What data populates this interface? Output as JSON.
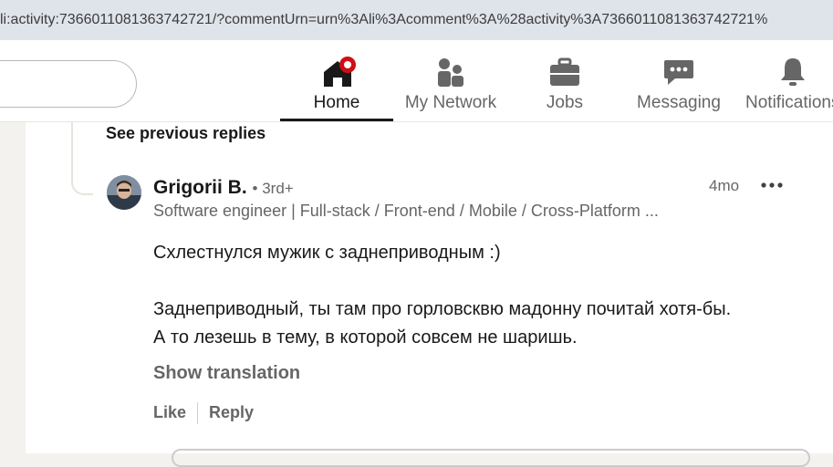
{
  "browser": {
    "url": "li:activity:7366011081363742721/?commentUrn=urn%3Ali%3Acomment%3A%28activity%3A7366011081363742721%"
  },
  "nav": {
    "items": [
      {
        "label": "Home",
        "icon": "home-icon",
        "active": true
      },
      {
        "label": "My Network",
        "icon": "network-icon",
        "active": false
      },
      {
        "label": "Jobs",
        "icon": "briefcase-icon",
        "active": false
      },
      {
        "label": "Messaging",
        "icon": "messaging-icon",
        "active": false
      },
      {
        "label": "Notifications",
        "icon": "bell-icon",
        "active": false
      }
    ],
    "notification_badge_color": "#cc1016"
  },
  "thread": {
    "see_previous": "See previous replies"
  },
  "comment": {
    "author": "Grigorii B.",
    "degree": "• 3rd+",
    "time": "4mo",
    "headline": "Software engineer | Full-stack / Front-end / Mobile / Cross-Platform ...",
    "body_line1": "Схлестнулся мужик с заднеприводным :)",
    "body_line2": "Заднеприводный, ты там про горловсквю мадонну почитай хотя-бы.",
    "body_line3": "А то лезешь в тему, в которой совсем не шаришь.",
    "show_translation": "Show translation",
    "like": "Like",
    "reply": "Reply"
  }
}
